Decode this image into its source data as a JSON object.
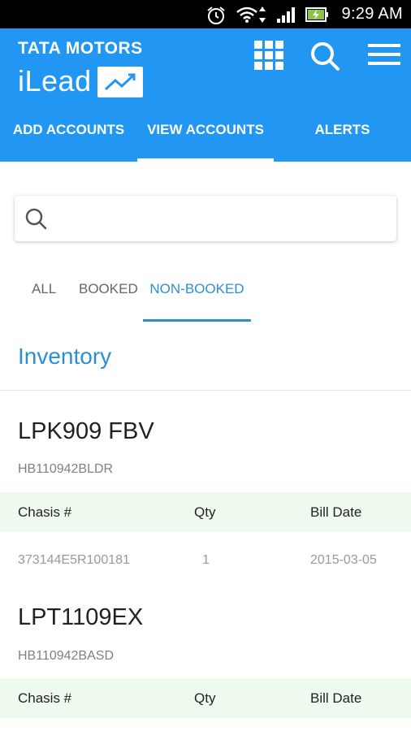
{
  "status_bar": {
    "time": "9:29 AM",
    "icons": [
      "alarm-icon",
      "wifi-icon",
      "data-arrows-icon",
      "signal-icon",
      "battery-charging-icon"
    ]
  },
  "header": {
    "brand": "TATA MOTORS",
    "app_name": "iLead",
    "icons": [
      "grid-icon",
      "search-icon",
      "menu-icon"
    ],
    "tabs": [
      {
        "label": "ADD ACCOUNTS",
        "active": false
      },
      {
        "label": "VIEW ACCOUNTS",
        "active": true
      },
      {
        "label": "ALERTS",
        "active": false
      }
    ]
  },
  "search": {
    "placeholder": "",
    "value": ""
  },
  "filters": [
    {
      "label": "ALL",
      "active": false
    },
    {
      "label": "BOOKED",
      "active": false
    },
    {
      "label": "NON-BOOKED",
      "active": true
    }
  ],
  "section_title": "Inventory",
  "columns": [
    "Chasis #",
    "Qty",
    "Bill Date"
  ],
  "items": [
    {
      "name": "LPK909 FBV",
      "code": "HB110942BLDR",
      "rows": [
        {
          "chasis": "373144E5R100181",
          "qty": "1",
          "bill_date": "2015-03-05"
        }
      ]
    },
    {
      "name": "LPT1109EX",
      "code": "HB110942BASD",
      "rows": []
    }
  ],
  "colors": {
    "primary": "#2196f3",
    "accent_text": "#2b8fd6",
    "table_header_bg": "#effaef",
    "status_bar": "#000000"
  }
}
